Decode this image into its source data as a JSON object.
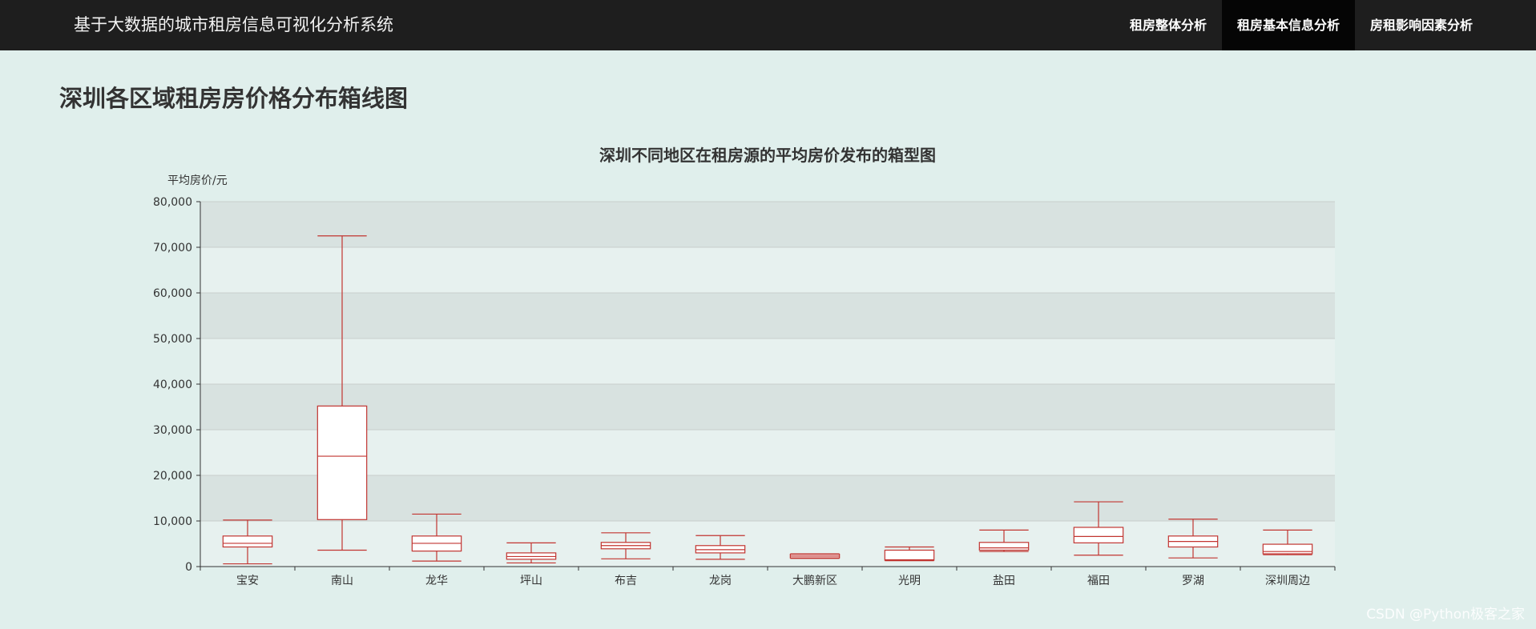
{
  "navbar": {
    "brand": "基于大数据的城市租房信息可视化分析系统",
    "items": [
      {
        "label": "租房整体分析",
        "active": false
      },
      {
        "label": "租房基本信息分析",
        "active": true
      },
      {
        "label": "房租影响因素分析",
        "active": false
      }
    ]
  },
  "page": {
    "title": "深圳各区域租房房价格分布箱线图"
  },
  "watermark": "CSDN @Python极客之家",
  "colors": {
    "box_stroke": "#c23531",
    "band_dark": "#d8e2e0",
    "band_light": "#e7f1ef",
    "axis": "#333333"
  },
  "chart_data": {
    "type": "boxplot",
    "title": "深圳不同地区在租房源的平均房价发布的箱型图",
    "ylabel": "平均房价/元",
    "xlabel": "",
    "ylim": [
      0,
      80000
    ],
    "yticks": [
      "0",
      "10,000",
      "20,000",
      "30,000",
      "40,000",
      "50,000",
      "60,000",
      "70,000",
      "80,000"
    ],
    "grid": true,
    "categories": [
      "宝安",
      "南山",
      "龙华",
      "坪山",
      "布吉",
      "龙岗",
      "大鹏新区",
      "光明",
      "盐田",
      "福田",
      "罗湖",
      "深圳周边"
    ],
    "boxes": [
      {
        "min": 600,
        "q1": 4300,
        "median": 5100,
        "q3": 6700,
        "max": 10200
      },
      {
        "min": 3600,
        "q1": 10300,
        "median": 24200,
        "q3": 35200,
        "max": 72500
      },
      {
        "min": 1200,
        "q1": 3400,
        "median": 5100,
        "q3": 6700,
        "max": 11500
      },
      {
        "min": 800,
        "q1": 1600,
        "median": 2200,
        "q3": 3000,
        "max": 5200
      },
      {
        "min": 1700,
        "q1": 3900,
        "median": 4600,
        "q3": 5300,
        "max": 7400
      },
      {
        "min": 1600,
        "q1": 3000,
        "median": 3700,
        "q3": 4600,
        "max": 6800
      },
      {
        "min": 1800,
        "q1": 1900,
        "median": 2300,
        "q3": 2700,
        "max": 2800
      },
      {
        "min": 1300,
        "q1": 1400,
        "median": 1500,
        "q3": 3600,
        "max": 4300
      },
      {
        "min": 3300,
        "q1": 3600,
        "median": 4100,
        "q3": 5300,
        "max": 8000
      },
      {
        "min": 2500,
        "q1": 5200,
        "median": 6600,
        "q3": 8600,
        "max": 14200
      },
      {
        "min": 1900,
        "q1": 4300,
        "median": 5500,
        "q3": 6700,
        "max": 10400
      },
      {
        "min": 2600,
        "q1": 2800,
        "median": 3300,
        "q3": 4900,
        "max": 8000
      }
    ]
  }
}
